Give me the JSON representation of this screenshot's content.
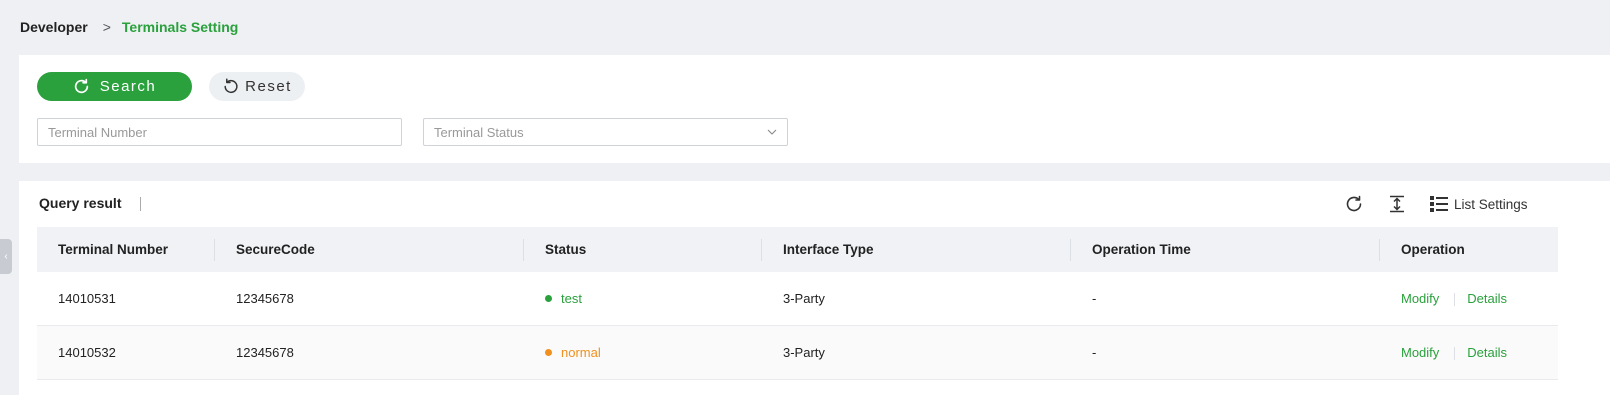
{
  "breadcrumb": {
    "root": "Developer",
    "separator": ">",
    "current": "Terminals Setting"
  },
  "search": {
    "search_label": "Search",
    "reset_label": "Reset",
    "terminal_placeholder": "Terminal Number",
    "status_placeholder": "Terminal Status"
  },
  "result": {
    "title": "Query result",
    "list_settings_label": "List Settings",
    "columns": [
      "Terminal Number",
      "SecureCode",
      "Status",
      "Interface Type",
      "Operation Time",
      "Operation"
    ],
    "rows": [
      {
        "terminal": "14010531",
        "secure": "12345678",
        "status": "test",
        "status_color": "#2aa13d",
        "interface": "3-Party",
        "time": "-",
        "modify": "Modify",
        "details": "Details"
      },
      {
        "terminal": "14010532",
        "secure": "12345678",
        "status": "normal",
        "status_color": "#f0901e",
        "interface": "3-Party",
        "time": "-",
        "modify": "Modify",
        "details": "Details"
      }
    ]
  },
  "colors": {
    "accent": "#2aa13d",
    "warning": "#f0901e"
  },
  "icons": [
    "refresh-icon",
    "undo-icon",
    "chevron-down-icon",
    "row-height-icon",
    "list-settings-icon",
    "collapse-sidebar-icon"
  ]
}
